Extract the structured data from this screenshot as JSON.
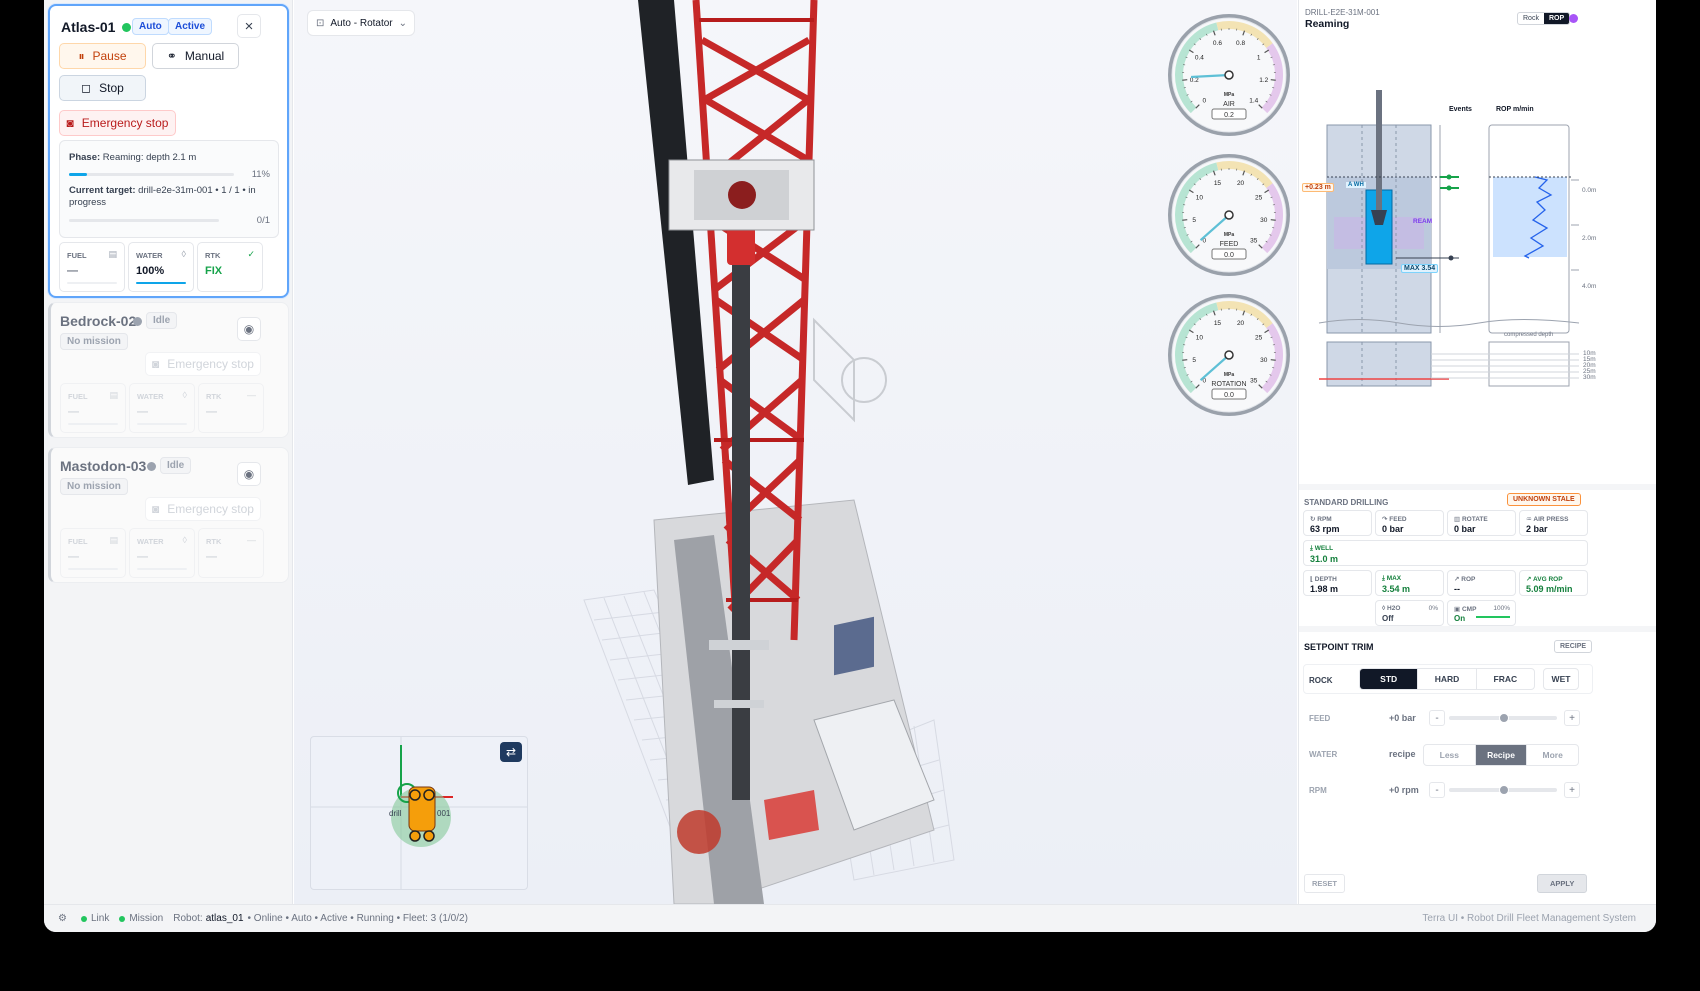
{
  "fleet": {
    "robots": [
      {
        "name": "Atlas-01",
        "status_color": "#22c55e",
        "badges": [
          "Auto",
          "Active"
        ],
        "buttons": {
          "pause": "Pause",
          "manual": "Manual",
          "stop": "Stop",
          "estop": "Emergency stop"
        },
        "phase_label": "Phase:",
        "phase_value": "Reaming: depth 2.1 m",
        "phase_progress_text": "11%",
        "phase_progress": 0.11,
        "target_label": "Current target:",
        "target_value": "drill-e2e-31m-001 • 1 / 1 • in progress",
        "target_count": "0/1",
        "stats": [
          {
            "label": "FUEL",
            "value": "—",
            "icon": "fuel-icon"
          },
          {
            "label": "WATER",
            "value": "100%",
            "icon": "water-drop-icon",
            "fill": 1.0
          },
          {
            "label": "RTK",
            "value": "FIX",
            "icon": "check-icon"
          }
        ]
      },
      {
        "name": "Bedrock-02",
        "status_color": "#9ca3af",
        "badge": "Idle",
        "mission": "No mission",
        "estop": "Emergency stop",
        "stats": [
          {
            "label": "FUEL",
            "value": "—"
          },
          {
            "label": "WATER",
            "value": "—"
          },
          {
            "label": "RTK",
            "value": "—"
          }
        ]
      },
      {
        "name": "Mastodon-03",
        "status_color": "#9ca3af",
        "badge": "Idle",
        "mission": "No mission",
        "estop": "Emergency stop",
        "stats": [
          {
            "label": "FUEL",
            "value": "—"
          },
          {
            "label": "WATER",
            "value": "—"
          },
          {
            "label": "RTK",
            "value": "—"
          }
        ]
      }
    ]
  },
  "viewport": {
    "mode_label": "Auto - Rotator",
    "gauges": [
      {
        "name": "AIR",
        "unit": "MPa",
        "value": "0.2",
        "ticks": [
          "0",
          "0.2",
          "0.4",
          "0.6",
          "0.8",
          "1",
          "1.2",
          "1.4"
        ]
      },
      {
        "name": "FEED",
        "unit": "MPa",
        "value": "0.0",
        "ticks": [
          "0",
          "5",
          "10",
          "15",
          "20",
          "25",
          "30",
          "35"
        ]
      },
      {
        "name": "ROTATION",
        "unit": "MPa",
        "value": "0.0",
        "ticks": [
          "0",
          "5",
          "10",
          "15",
          "20",
          "25",
          "30",
          "35"
        ]
      }
    ],
    "minimap": {
      "label_left": "drill",
      "label_right": "001"
    }
  },
  "right": {
    "drill_id": "DRILL-E2E-31M-001",
    "state": "Reaming",
    "toggle": [
      "Rock",
      "ROP"
    ],
    "diagram": {
      "events_label": "Events",
      "rop_label": "ROP m/min",
      "offset": "+0.23 m",
      "awh": "A WH",
      "ream": "REAM",
      "max": "MAX 3.54",
      "depth_ticks": [
        "0.0m",
        "2.0m",
        "4.0m"
      ],
      "compressed": "compressed depth",
      "deep_ticks": [
        "10m",
        "15m",
        "20m",
        "25m",
        "30m"
      ]
    },
    "std": {
      "title": "STANDARD DRILLING",
      "badge": "UNKNOWN STALE",
      "cells": [
        {
          "label": "RPM",
          "value": "63 rpm"
        },
        {
          "label": "FEED",
          "value": "0 bar"
        },
        {
          "label": "ROTATE",
          "value": "0 bar"
        },
        {
          "label": "AIR PRESS",
          "value": "2 bar"
        }
      ],
      "well": {
        "label": "WELL",
        "value": "31.0 m"
      },
      "cells2": [
        {
          "label": "DEPTH",
          "value": "1.98 m"
        },
        {
          "label": "MAX",
          "value": "3.54 m"
        },
        {
          "label": "ROP",
          "value": "--"
        },
        {
          "label": "AVG ROP",
          "value": "5.09 m/min"
        }
      ],
      "h2o": {
        "label": "H2O",
        "pct": "0%",
        "state": "Off"
      },
      "cmp": {
        "label": "CMP",
        "pct": "100%",
        "state": "On"
      }
    },
    "trim": {
      "title": "SETPOINT TRIM",
      "recipe_btn": "RECIPE",
      "rock_label": "ROCK",
      "rock_opts": [
        "STD",
        "HARD",
        "FRAC"
      ],
      "wet": "WET",
      "feed_label": "FEED",
      "feed_value": "+0 bar",
      "water_label": "WATER",
      "water_value": "recipe",
      "water_opts": [
        "Less",
        "Recipe",
        "More"
      ],
      "rpm_label": "RPM",
      "rpm_value": "+0 rpm",
      "reset": "RESET",
      "apply": "APPLY"
    }
  },
  "status": {
    "link": "Link",
    "mission": "Mission",
    "robot_label": "Robot:",
    "robot": "atlas_01",
    "rest": "• Online • Auto • Active • Running • Fleet: 3 (1/0/2)",
    "app": "Terra UI • Robot Drill Fleet Management System"
  }
}
